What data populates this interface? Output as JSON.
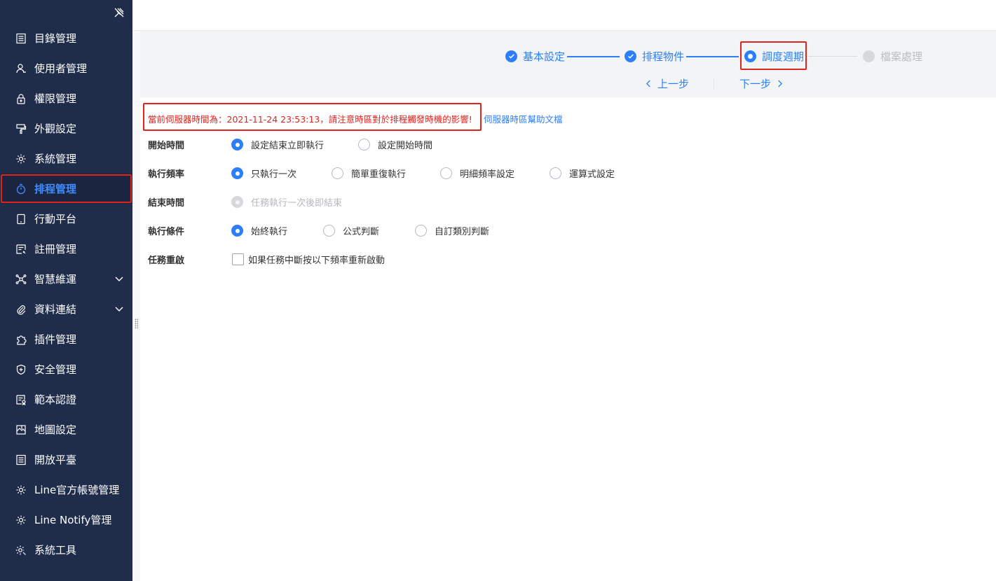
{
  "sidebar": {
    "pin_icon": "pin-off-icon",
    "items": [
      {
        "label": "目錄管理",
        "icon": "list-icon"
      },
      {
        "label": "使用者管理",
        "icon": "user-icon"
      },
      {
        "label": "權限管理",
        "icon": "lock-icon"
      },
      {
        "label": "外觀設定",
        "icon": "brush-icon"
      },
      {
        "label": "系統管理",
        "icon": "gear-icon"
      },
      {
        "label": "排程管理",
        "icon": "timer-icon",
        "active": true
      },
      {
        "label": "行動平台",
        "icon": "tablet-icon"
      },
      {
        "label": "註冊管理",
        "icon": "register-icon"
      },
      {
        "label": "智慧維運",
        "icon": "network-icon",
        "expandable": true
      },
      {
        "label": "資料連結",
        "icon": "paperclip-icon",
        "expandable": true
      },
      {
        "label": "插件管理",
        "icon": "puzzle-icon"
      },
      {
        "label": "安全管理",
        "icon": "shield-icon"
      },
      {
        "label": "範本認證",
        "icon": "certificate-icon"
      },
      {
        "label": "地圖設定",
        "icon": "map-icon"
      },
      {
        "label": "開放平臺",
        "icon": "list-icon"
      },
      {
        "label": "Line官方帳號管理",
        "icon": "gear-icon"
      },
      {
        "label": "Line Notify管理",
        "icon": "gear-icon"
      },
      {
        "label": "系統工具",
        "icon": "gear-tool-icon"
      }
    ]
  },
  "steps": [
    {
      "label": "基本設定",
      "status": "done"
    },
    {
      "label": "排程物件",
      "status": "done"
    },
    {
      "label": "調度週期",
      "status": "current"
    },
    {
      "label": "檔案處理",
      "status": "todo"
    }
  ],
  "pager": {
    "prev": "上一步",
    "next": "下一步"
  },
  "notice": {
    "text": "當前伺服器時間為：2021-11-24 23:53:13，請注意時區對於排程觸發時機的影響!",
    "help_link": "伺服器時區幫助文檔"
  },
  "form": {
    "start_time": {
      "label": "開始時間",
      "options": [
        "設定結束立即執行",
        "設定開始時間"
      ],
      "selected": 0
    },
    "frequency": {
      "label": "執行頻率",
      "options": [
        "只執行一次",
        "簡單重復執行",
        "明細頻率設定",
        "運算式設定"
      ],
      "selected": 0
    },
    "end_time": {
      "label": "結束時間",
      "options": [
        "任務執行一次後即結束"
      ],
      "selected": 0,
      "disabled": true
    },
    "condition": {
      "label": "執行條件",
      "options": [
        "始終執行",
        "公式判斷",
        "自訂類別判斷"
      ],
      "selected": 0
    },
    "restart": {
      "label": "任務重啟",
      "checkbox_label": "如果任務中斷按以下頻率重新啟動",
      "checked": false
    }
  },
  "colors": {
    "sidebar_bg": "#1f2d4b",
    "accent": "#2d7ff9",
    "highlight_red": "#e0231c"
  }
}
